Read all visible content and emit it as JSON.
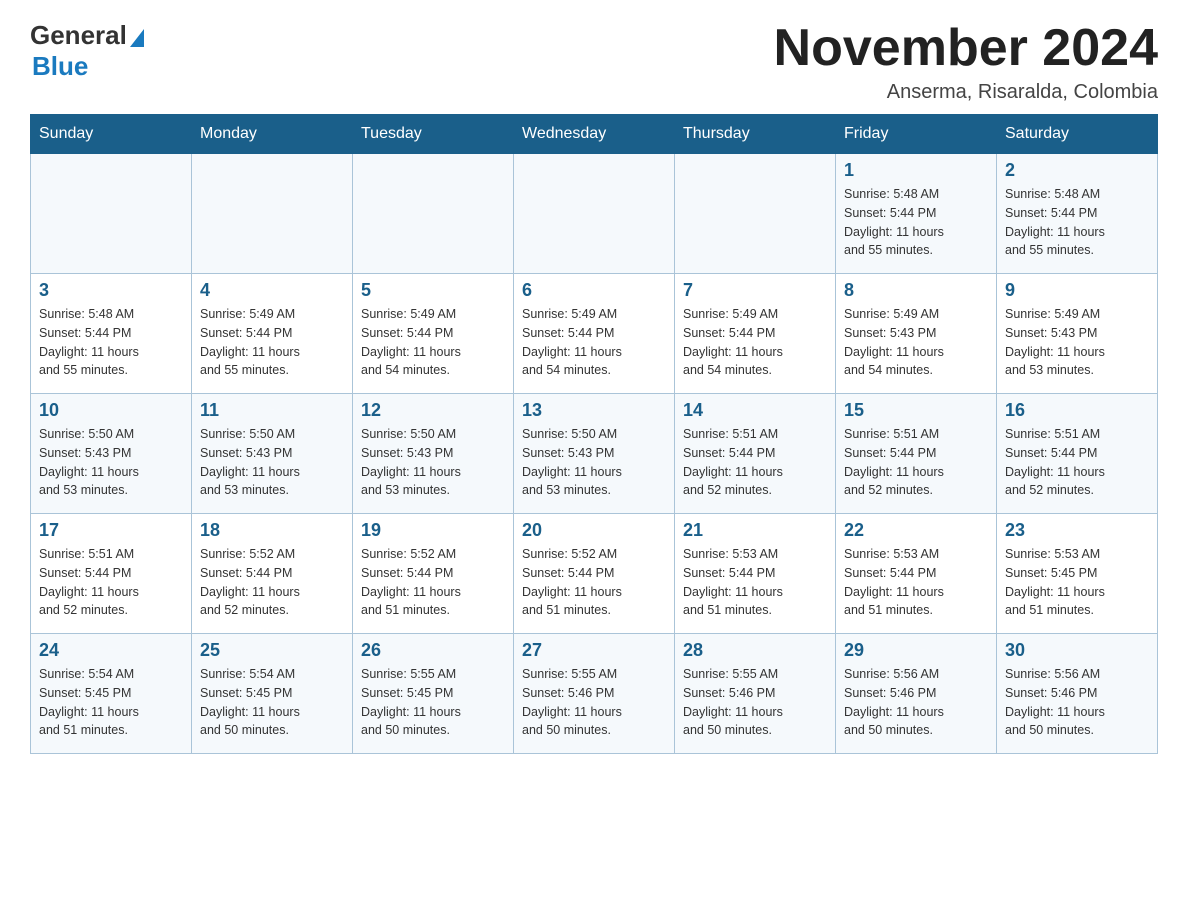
{
  "logo": {
    "general": "General",
    "blue": "Blue"
  },
  "header": {
    "month_year": "November 2024",
    "location": "Anserma, Risaralda, Colombia"
  },
  "days_of_week": [
    "Sunday",
    "Monday",
    "Tuesday",
    "Wednesday",
    "Thursday",
    "Friday",
    "Saturday"
  ],
  "weeks": [
    {
      "days": [
        {
          "num": "",
          "info": ""
        },
        {
          "num": "",
          "info": ""
        },
        {
          "num": "",
          "info": ""
        },
        {
          "num": "",
          "info": ""
        },
        {
          "num": "",
          "info": ""
        },
        {
          "num": "1",
          "info": "Sunrise: 5:48 AM\nSunset: 5:44 PM\nDaylight: 11 hours\nand 55 minutes."
        },
        {
          "num": "2",
          "info": "Sunrise: 5:48 AM\nSunset: 5:44 PM\nDaylight: 11 hours\nand 55 minutes."
        }
      ]
    },
    {
      "days": [
        {
          "num": "3",
          "info": "Sunrise: 5:48 AM\nSunset: 5:44 PM\nDaylight: 11 hours\nand 55 minutes."
        },
        {
          "num": "4",
          "info": "Sunrise: 5:49 AM\nSunset: 5:44 PM\nDaylight: 11 hours\nand 55 minutes."
        },
        {
          "num": "5",
          "info": "Sunrise: 5:49 AM\nSunset: 5:44 PM\nDaylight: 11 hours\nand 54 minutes."
        },
        {
          "num": "6",
          "info": "Sunrise: 5:49 AM\nSunset: 5:44 PM\nDaylight: 11 hours\nand 54 minutes."
        },
        {
          "num": "7",
          "info": "Sunrise: 5:49 AM\nSunset: 5:44 PM\nDaylight: 11 hours\nand 54 minutes."
        },
        {
          "num": "8",
          "info": "Sunrise: 5:49 AM\nSunset: 5:43 PM\nDaylight: 11 hours\nand 54 minutes."
        },
        {
          "num": "9",
          "info": "Sunrise: 5:49 AM\nSunset: 5:43 PM\nDaylight: 11 hours\nand 53 minutes."
        }
      ]
    },
    {
      "days": [
        {
          "num": "10",
          "info": "Sunrise: 5:50 AM\nSunset: 5:43 PM\nDaylight: 11 hours\nand 53 minutes."
        },
        {
          "num": "11",
          "info": "Sunrise: 5:50 AM\nSunset: 5:43 PM\nDaylight: 11 hours\nand 53 minutes."
        },
        {
          "num": "12",
          "info": "Sunrise: 5:50 AM\nSunset: 5:43 PM\nDaylight: 11 hours\nand 53 minutes."
        },
        {
          "num": "13",
          "info": "Sunrise: 5:50 AM\nSunset: 5:43 PM\nDaylight: 11 hours\nand 53 minutes."
        },
        {
          "num": "14",
          "info": "Sunrise: 5:51 AM\nSunset: 5:44 PM\nDaylight: 11 hours\nand 52 minutes."
        },
        {
          "num": "15",
          "info": "Sunrise: 5:51 AM\nSunset: 5:44 PM\nDaylight: 11 hours\nand 52 minutes."
        },
        {
          "num": "16",
          "info": "Sunrise: 5:51 AM\nSunset: 5:44 PM\nDaylight: 11 hours\nand 52 minutes."
        }
      ]
    },
    {
      "days": [
        {
          "num": "17",
          "info": "Sunrise: 5:51 AM\nSunset: 5:44 PM\nDaylight: 11 hours\nand 52 minutes."
        },
        {
          "num": "18",
          "info": "Sunrise: 5:52 AM\nSunset: 5:44 PM\nDaylight: 11 hours\nand 52 minutes."
        },
        {
          "num": "19",
          "info": "Sunrise: 5:52 AM\nSunset: 5:44 PM\nDaylight: 11 hours\nand 51 minutes."
        },
        {
          "num": "20",
          "info": "Sunrise: 5:52 AM\nSunset: 5:44 PM\nDaylight: 11 hours\nand 51 minutes."
        },
        {
          "num": "21",
          "info": "Sunrise: 5:53 AM\nSunset: 5:44 PM\nDaylight: 11 hours\nand 51 minutes."
        },
        {
          "num": "22",
          "info": "Sunrise: 5:53 AM\nSunset: 5:44 PM\nDaylight: 11 hours\nand 51 minutes."
        },
        {
          "num": "23",
          "info": "Sunrise: 5:53 AM\nSunset: 5:45 PM\nDaylight: 11 hours\nand 51 minutes."
        }
      ]
    },
    {
      "days": [
        {
          "num": "24",
          "info": "Sunrise: 5:54 AM\nSunset: 5:45 PM\nDaylight: 11 hours\nand 51 minutes."
        },
        {
          "num": "25",
          "info": "Sunrise: 5:54 AM\nSunset: 5:45 PM\nDaylight: 11 hours\nand 50 minutes."
        },
        {
          "num": "26",
          "info": "Sunrise: 5:55 AM\nSunset: 5:45 PM\nDaylight: 11 hours\nand 50 minutes."
        },
        {
          "num": "27",
          "info": "Sunrise: 5:55 AM\nSunset: 5:46 PM\nDaylight: 11 hours\nand 50 minutes."
        },
        {
          "num": "28",
          "info": "Sunrise: 5:55 AM\nSunset: 5:46 PM\nDaylight: 11 hours\nand 50 minutes."
        },
        {
          "num": "29",
          "info": "Sunrise: 5:56 AM\nSunset: 5:46 PM\nDaylight: 11 hours\nand 50 minutes."
        },
        {
          "num": "30",
          "info": "Sunrise: 5:56 AM\nSunset: 5:46 PM\nDaylight: 11 hours\nand 50 minutes."
        }
      ]
    }
  ]
}
